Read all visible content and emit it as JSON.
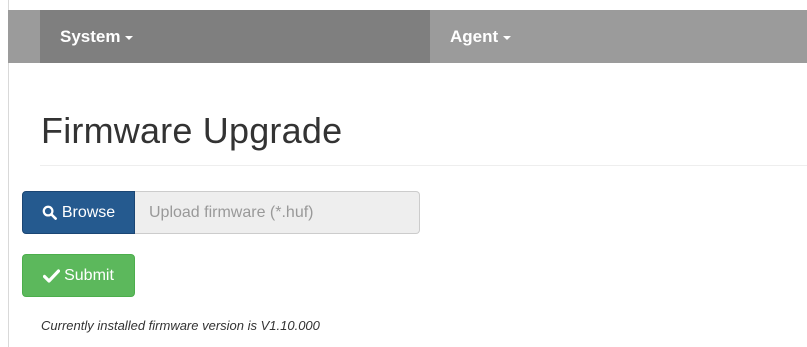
{
  "nav": {
    "items": [
      {
        "label": "System"
      },
      {
        "label": "Agent"
      }
    ]
  },
  "page": {
    "title": "Firmware Upgrade"
  },
  "upload": {
    "browse_label": "Browse",
    "placeholder": "Upload firmware (*.huf)",
    "value": ""
  },
  "submit": {
    "label": "Submit"
  },
  "firmware": {
    "version_text": "Currently installed firmware version is V1.10.000"
  },
  "colors": {
    "navbar": "#9b9b9b",
    "nav_active": "#7f7f7f",
    "browse": "#255a8f",
    "submit": "#5cb85c"
  },
  "icons": {
    "browse": "search-icon",
    "submit": "check-icon",
    "dropdown": "caret-down-icon"
  }
}
